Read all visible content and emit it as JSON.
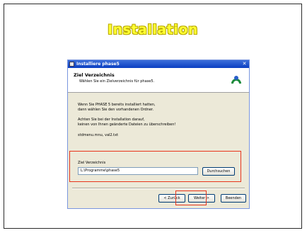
{
  "slide": {
    "title": "Installation"
  },
  "window": {
    "title": "Installiere phase5",
    "close_glyph": "✕",
    "header_title": "Ziel Verzeichnis",
    "header_subtitle": "Wählen Sie ein Zielverzeichnis für phase5.",
    "text1_line1": "Wenn Sie PHASE 5 bereits installiert hatten,",
    "text1_line2": "dann wählen Sie den vorhandenen Ordner.",
    "text2_line1": "Achten Sie bei der Installation darauf,",
    "text2_line2": "keinen von Ihnen geänderte Dateien zu überschreiben!",
    "text3": "stdmenu.mnu, val2.txt",
    "dest_label": "Ziel Verzeichnis",
    "dest_value": "L:\\Programme\\phase5",
    "browse_label": "Durchsuchen",
    "back_label": "< Zurück",
    "next_label": "Weiter >",
    "finish_label": "Beenden"
  },
  "colors": {
    "title_yellow": "#ffff33",
    "highlight_red": "#e8351c",
    "titlebar_blue": "#0a3fc2"
  },
  "icons": {
    "logo": "phase5-logo-icon"
  }
}
